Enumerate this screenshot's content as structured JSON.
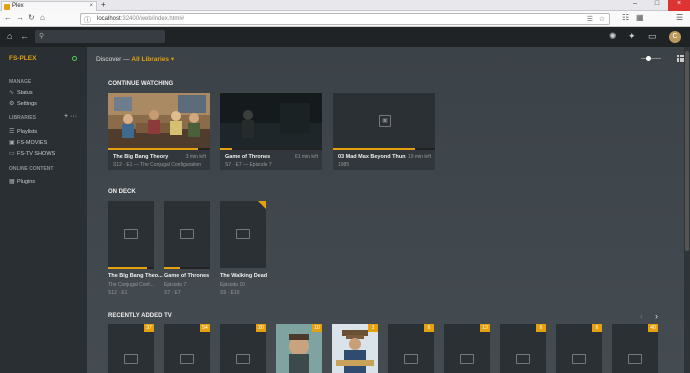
{
  "browser": {
    "tab_title": "Plex",
    "tab_close": "×",
    "new_tab": "+",
    "url_host": "localhost",
    "url_rest": ":32400/web/index.html#",
    "window_controls": [
      "–",
      "□",
      "×"
    ]
  },
  "top": {
    "search_icon": "search-icon",
    "avatar_letter": "C"
  },
  "sidebar": {
    "server": "FS-PLEX",
    "manage_heading": "MANAGE",
    "manage_items": [
      "Status",
      "Settings"
    ],
    "libraries_heading": "LIBRARIES",
    "library_items": [
      "Playlists",
      "FS-MOVIES",
      "FS-TV SHOWS"
    ],
    "online_heading": "ONLINE CONTENT",
    "online_items": [
      "Plugins"
    ],
    "add": "+",
    "more": "···"
  },
  "main": {
    "discover_label": "Discover",
    "discover_sep": "—",
    "library_selector": "All Libraries",
    "continue_watching": "CONTINUE WATCHING",
    "on_deck": "ON DECK",
    "recently_added": "RECENTLY ADDED TV"
  },
  "continue_watching": [
    {
      "title": "The Big Bang Theory",
      "subtitle": "S12 · E1 — The Conjugal Configuration",
      "time_left": "3 min left",
      "progress": 0.88
    },
    {
      "title": "Game of Thrones",
      "subtitle": "S7 · E7 — Episode 7",
      "time_left": "61 min left",
      "progress": 0.12
    },
    {
      "title": "03 Mad Max Beyond Thun...",
      "subtitle": "1985",
      "time_left": "19 min left",
      "progress": 0.8
    }
  ],
  "on_deck": [
    {
      "title": "The Big Bang Theo...",
      "subtitle": "The Conjugal Conf...",
      "episode": "S12 · E1",
      "progress": 0.85
    },
    {
      "title": "Game of Thrones",
      "subtitle": "Episode 7",
      "episode": "S7 · E7",
      "progress": 0.35
    },
    {
      "title": "The Walking Dead",
      "subtitle": "Episode 10",
      "episode": "S9 · E10",
      "progress": 0
    }
  ],
  "recently_added_badges": [
    "37",
    "54",
    "20",
    "10",
    "3",
    "6",
    "13",
    "6",
    "6",
    "40"
  ],
  "colors": {
    "accent": "#e5a00d",
    "bg": "#3a4046",
    "sidebar": "#2a2f34"
  }
}
